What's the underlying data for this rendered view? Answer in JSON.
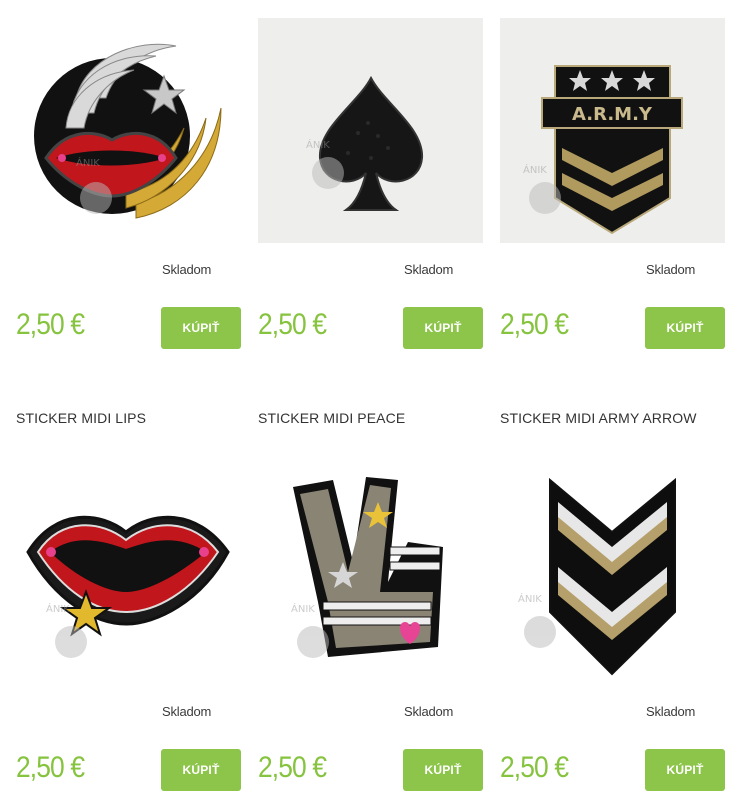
{
  "products": [
    {
      "title": "",
      "stock": "Skladom",
      "price": "2,50 €",
      "buy_label": "KÚPIŤ",
      "icon": "lips-wings-star-patch"
    },
    {
      "title": "",
      "stock": "Skladom",
      "price": "2,50 €",
      "buy_label": "KÚPIŤ",
      "icon": "spade-patch"
    },
    {
      "title": "",
      "stock": "Skladom",
      "price": "2,50 €",
      "buy_label": "KÚPIŤ",
      "icon": "army-badge-patch",
      "patch_text": "A.R.M.Y"
    },
    {
      "title": "STICKER MIDI LIPS",
      "stock": "Skladom",
      "price": "2,50 €",
      "buy_label": "KÚPIŤ",
      "icon": "lips-patch"
    },
    {
      "title": "STICKER MIDI PEACE",
      "stock": "Skladom",
      "price": "2,50 €",
      "buy_label": "KÚPIŤ",
      "icon": "peace-hand-patch"
    },
    {
      "title": "STICKER MIDI ARMY ARROW",
      "stock": "Skladom",
      "price": "2,50 €",
      "buy_label": "KÚPIŤ",
      "icon": "army-arrow-patch"
    }
  ],
  "colors": {
    "price": "#86c33f",
    "button": "#8dc44a",
    "text": "#333333"
  }
}
